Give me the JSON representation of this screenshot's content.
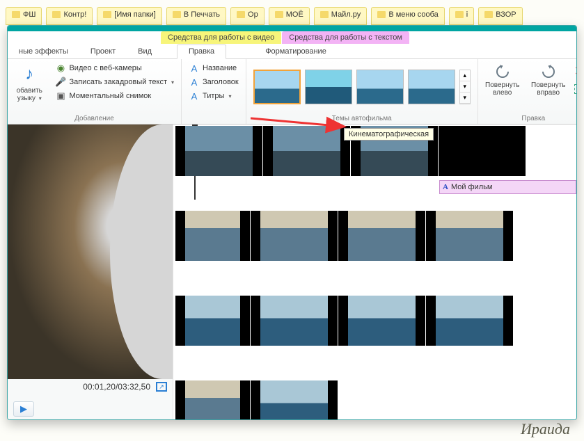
{
  "folders": [
    "ФШ",
    "Контр!",
    "[Имя папки]",
    "В Печчать",
    "Ор",
    "МОЁ",
    "Майл.ру",
    "В меню сооба",
    "і",
    "ВЗОР"
  ],
  "ctx_tabs": {
    "video": "Средства для работы с видео",
    "text": "Средства для работы с текстом"
  },
  "tabs": {
    "effects": "ные эффекты",
    "project": "Проект",
    "view": "Вид",
    "edit": "Правка",
    "format": "Форматирование"
  },
  "ribbon": {
    "add_music_top": "обавить",
    "add_music_bot": "узыку",
    "webcam": "Видео с веб-камеры",
    "voiceover": "Записать закадровый текст",
    "snapshot": "Моментальный снимок",
    "group_add": "Добавление",
    "title": "Название",
    "header": "Заголовок",
    "captions": "Титры",
    "group_themes": "Темы автофильма",
    "rotate_left": "Повернуть влево",
    "rotate_right": "Повернуть вправо",
    "group_edit": "Правка"
  },
  "tooltip": "Кинематографическая",
  "preview": {
    "time": "00:01,20/03:32,50"
  },
  "text_track": "Мой фильм",
  "signature": "Ираида"
}
